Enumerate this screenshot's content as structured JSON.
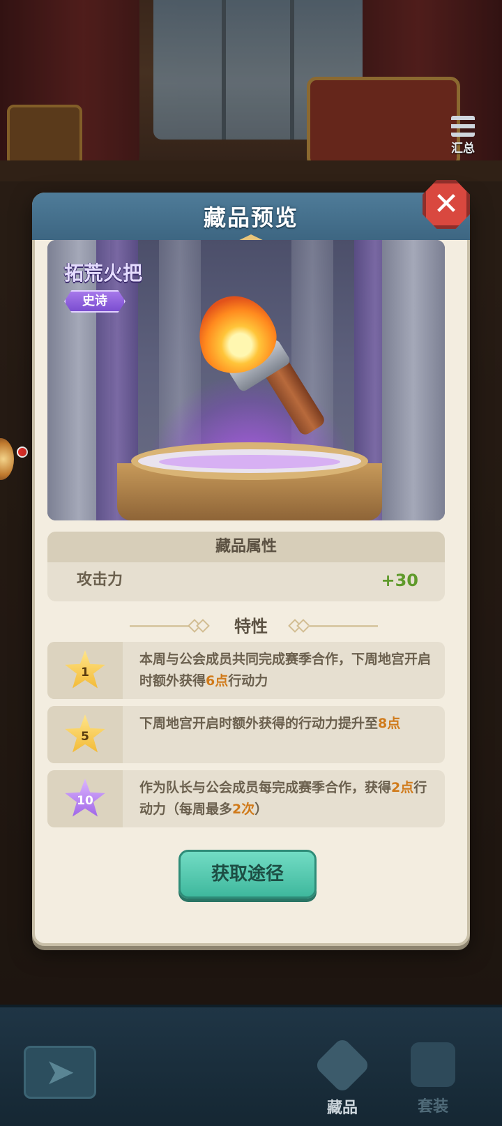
{
  "summary": {
    "label": "汇总"
  },
  "modal": {
    "title": "藏品预览",
    "item_name": "拓荒火把",
    "rarity": "史诗",
    "attributes": {
      "header": "藏品属性",
      "rows": [
        {
          "name": "攻击力",
          "value": "+30"
        }
      ]
    },
    "traits_title": "特性",
    "traits": [
      {
        "level": "1",
        "star_color": "gold",
        "parts": [
          "本周与公会成员共同完成赛季合作，下周地宫开启时额外获得",
          "6点",
          "行动力"
        ]
      },
      {
        "level": "5",
        "star_color": "gold",
        "parts": [
          "下周地宫开启时额外获得的行动力提升至",
          "8点",
          ""
        ]
      },
      {
        "level": "10",
        "star_color": "purple",
        "parts": [
          "作为队长与公会成员每完成赛季合作，获得",
          "2点",
          "行动力（每周最多",
          "2次",
          "）"
        ]
      }
    ],
    "get_button": "获取途径"
  },
  "bottom_nav": {
    "items": [
      {
        "label": "藏品",
        "active": true
      },
      {
        "label": "套装",
        "active": false
      }
    ]
  },
  "colors": {
    "header": "#4f7c99",
    "close": "#d9483f",
    "highlight": "#d07a1a",
    "positive": "#5f9a2b",
    "button": "#4fc6ab"
  }
}
